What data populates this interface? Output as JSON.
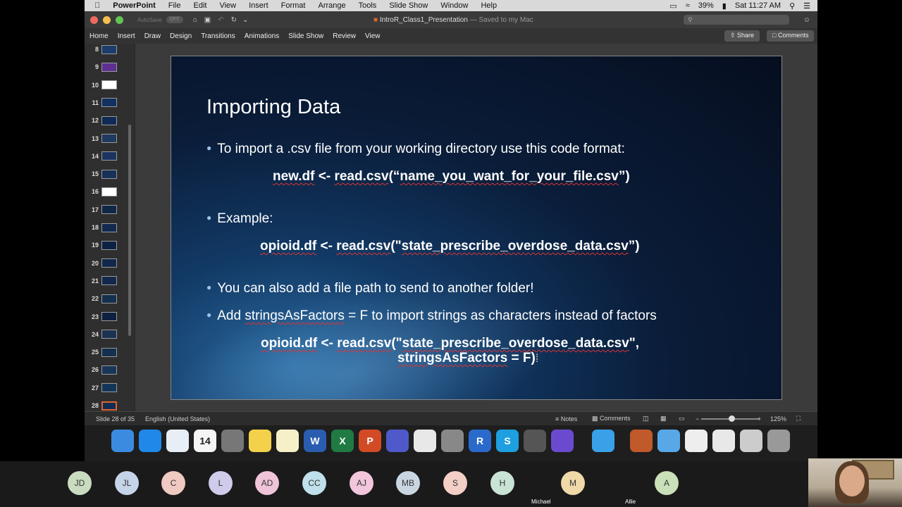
{
  "menubar": {
    "app_name": "PowerPoint",
    "items": [
      "File",
      "Edit",
      "View",
      "Insert",
      "Format",
      "Arrange",
      "Tools",
      "Slide Show",
      "Window",
      "Help"
    ],
    "battery": "39%",
    "clock": "Sat 11:27 AM"
  },
  "titlebar": {
    "autosave": "AutoSave",
    "autosave_state": "OFF",
    "doc_title": "IntroR_Class1_Presentation",
    "saved": "— Saved to my Mac"
  },
  "ribbon": {
    "tabs": [
      "Home",
      "Insert",
      "Draw",
      "Design",
      "Transitions",
      "Animations",
      "Slide Show",
      "Review",
      "View"
    ],
    "share_label": "Share",
    "comments_label": "Comments"
  },
  "thumbnails": {
    "numbers": [
      "8",
      "9",
      "10",
      "11",
      "12",
      "13",
      "14",
      "15",
      "16",
      "17",
      "18",
      "19",
      "20",
      "21",
      "22",
      "23",
      "24",
      "25",
      "26",
      "27",
      "28"
    ],
    "selected": "28"
  },
  "slide": {
    "title": "Importing Data",
    "bullet1": "To import a .csv file from your working directory use this code format:",
    "code1_a": "new.df",
    "code1_b": " <- ",
    "code1_c": "read.csv",
    "code1_d": "(“",
    "code1_e": "name_you_want_for_your_file.csv",
    "code1_f": "”)",
    "bullet2": "Example:",
    "code2_a": "opioid.df",
    "code2_b": " <- ",
    "code2_c": "read.csv",
    "code2_d": "(\"",
    "code2_e": "state_prescribe_overdose_data.csv",
    "code2_f": "”)",
    "bullet3": "You can also add a file path to send to another folder!",
    "bullet4_a": "Add ",
    "bullet4_b": "stringsAsFactors",
    "bullet4_c": " = F to import strings as characters instead of factors",
    "code3_a": "opioid.df",
    "code3_b": " <- ",
    "code3_c": "read.csv",
    "code3_d": "(\"",
    "code3_e": "state_prescribe_overdose_data.csv",
    "code3_f": "\",",
    "code3_g": "stringsAsFactors",
    "code3_h": " = F)"
  },
  "status": {
    "slide_count": "Slide 28 of 35",
    "language": "English (United States)",
    "notes": "Notes",
    "comments": "Comments",
    "zoom": "125%"
  },
  "dock": {
    "icons": [
      "finder-icon",
      "app-store-icon",
      "itunes-icon",
      "calendar-icon",
      "calculator-icon",
      "stickies-icon",
      "notes-icon",
      "word-icon",
      "excel-icon",
      "powerpoint-icon",
      "teams-icon",
      "chrome-icon",
      "system-preferences-icon",
      "r-icon",
      "skype-icon",
      "camera-icon",
      "imovie-icon",
      "messages-icon",
      "garageband-icon",
      "folder-icon",
      "document-icon",
      "preview-icon",
      "screenshot-icon",
      "trash-icon"
    ],
    "calendar_day": "14"
  },
  "participants": [
    {
      "initials": "JD",
      "color": "#c9dcc0"
    },
    {
      "initials": "JL",
      "color": "#c6d4ea"
    },
    {
      "initials": "C",
      "color": "#f1c9c3"
    },
    {
      "initials": "L",
      "color": "#cfcbea"
    },
    {
      "initials": "AD",
      "color": "#f0c4d8"
    },
    {
      "initials": "CC",
      "color": "#bfe0ea"
    },
    {
      "initials": "AJ",
      "color": "#f2c6dd"
    },
    {
      "initials": "MB",
      "color": "#c9d6e2"
    },
    {
      "initials": "S",
      "color": "#f3cfc6"
    },
    {
      "initials": "H",
      "color": "#c9e3d4"
    },
    {
      "initials": "M",
      "color": "#f0d9a8",
      "name": "Michael"
    },
    {
      "initials": "A",
      "color": "#c9e0b8",
      "name": "Allie"
    }
  ]
}
